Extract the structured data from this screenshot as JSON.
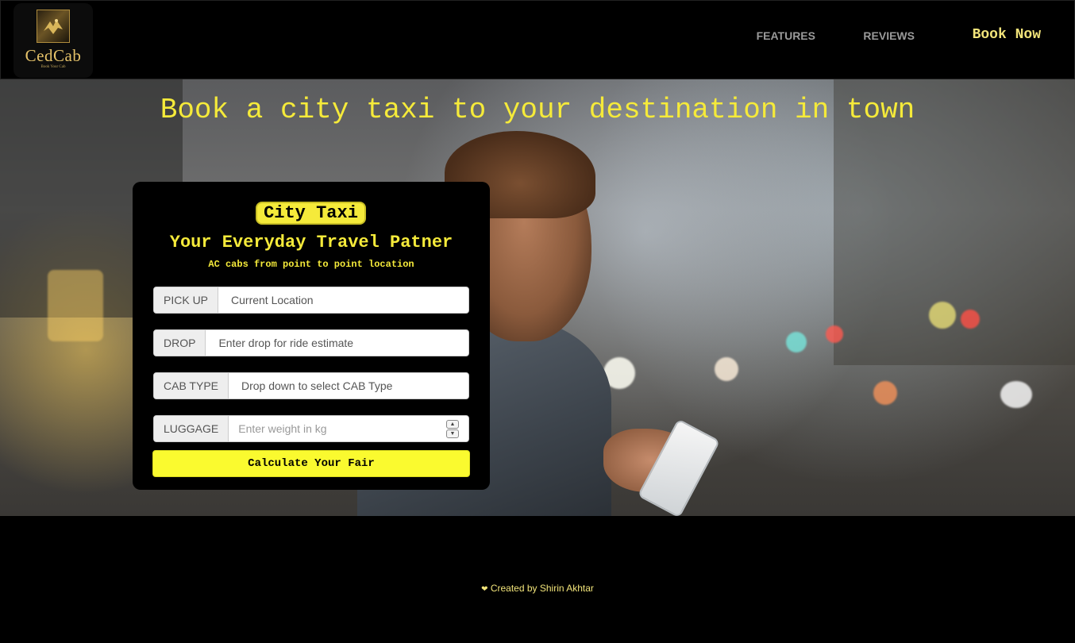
{
  "brand": {
    "name": "CedCab",
    "tagline": "Book Your Cab"
  },
  "nav": {
    "features": "FEATURES",
    "reviews": "REVIEWS",
    "book_now": "Book Now"
  },
  "hero": {
    "title": "Book a city taxi to your destination in town"
  },
  "card": {
    "badge": "City Taxi",
    "title": "Your Everyday Travel Patner",
    "subtitle": "AC cabs from point to point location",
    "pickup": {
      "label": "PICK UP",
      "value": "Current Location"
    },
    "drop": {
      "label": "DROP",
      "value": "Enter drop for ride estimate"
    },
    "cab_type": {
      "label": "CAB TYPE",
      "value": "Drop down to select CAB Type"
    },
    "luggage": {
      "label": "LUGGAGE",
      "placeholder": "Enter weight in kg"
    },
    "submit": "Calculate Your Fair"
  },
  "footer": {
    "credit": "Created by Shirin Akhtar"
  },
  "colors": {
    "accent": "#f5ea3a",
    "background": "#000000",
    "button": "#fafa2f"
  }
}
